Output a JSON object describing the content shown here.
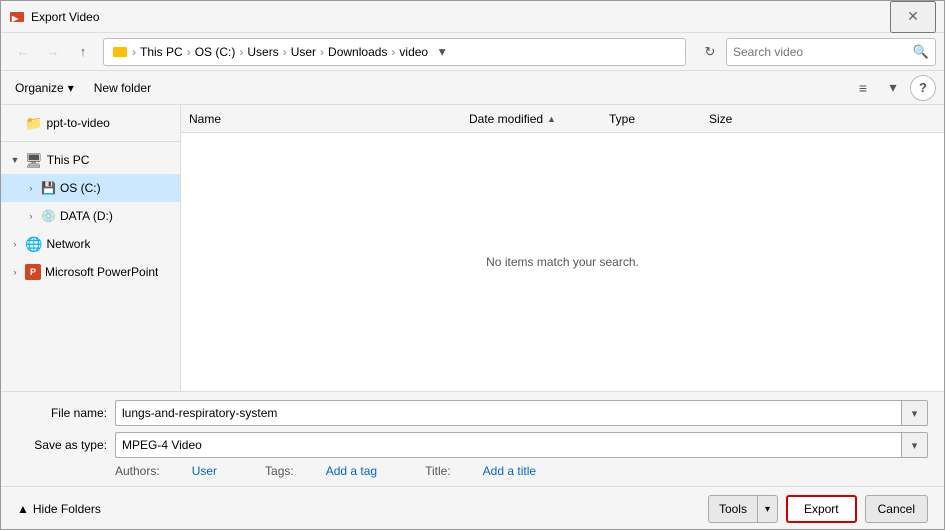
{
  "window": {
    "title": "Export Video",
    "close_label": "✕"
  },
  "nav": {
    "back_label": "←",
    "forward_label": "→",
    "up_label": "↑",
    "breadcrumb": [
      {
        "label": "This PC"
      },
      {
        "label": "OS (C:)"
      },
      {
        "label": "Users"
      },
      {
        "label": "User"
      },
      {
        "label": "Downloads"
      },
      {
        "label": "video"
      }
    ],
    "refresh_label": "↻"
  },
  "search": {
    "placeholder": "Search video",
    "icon": "🔍"
  },
  "toolbar": {
    "organize_label": "Organize",
    "new_folder_label": "New folder",
    "view_icon": "≡",
    "view_dropdown": "▾",
    "help_label": "?"
  },
  "sidebar": {
    "items": [
      {
        "id": "ppt-to-video",
        "label": "ppt-to-video",
        "icon": "folder",
        "color": "yellow",
        "indent": 0
      },
      {
        "id": "this-pc",
        "label": "This PC",
        "icon": "computer",
        "indent": 0,
        "expandable": true,
        "expanded": true
      },
      {
        "id": "os-c",
        "label": "OS (C:)",
        "icon": "drive",
        "indent": 1,
        "expandable": true,
        "selected": true
      },
      {
        "id": "data-d",
        "label": "DATA (D:)",
        "icon": "drive",
        "indent": 1,
        "expandable": true
      },
      {
        "id": "network",
        "label": "Network",
        "icon": "network",
        "indent": 0,
        "expandable": true
      },
      {
        "id": "powerpoint",
        "label": "Microsoft PowerPoint",
        "icon": "ppt",
        "indent": 0,
        "expandable": true
      }
    ]
  },
  "file_list": {
    "columns": [
      {
        "id": "name",
        "label": "Name",
        "sortable": true
      },
      {
        "id": "date",
        "label": "Date modified",
        "sortable": true,
        "sort_dir": "▲"
      },
      {
        "id": "type",
        "label": "Type"
      },
      {
        "id": "size",
        "label": "Size"
      }
    ],
    "empty_message": "No items match your search."
  },
  "form": {
    "file_name_label": "File name:",
    "file_name_value": "lungs-and-respiratory-system",
    "save_as_label": "Save as type:",
    "save_as_value": "MPEG-4 Video",
    "authors_label": "Authors:",
    "authors_value": "User",
    "tags_label": "Tags:",
    "tags_value": "Add a tag",
    "title_label": "Title:",
    "title_value": "Add a title"
  },
  "actions": {
    "hide_folders_label": "Hide Folders",
    "tools_label": "Tools",
    "export_label": "Export",
    "cancel_label": "Cancel",
    "hide_folders_icon": "▲"
  }
}
